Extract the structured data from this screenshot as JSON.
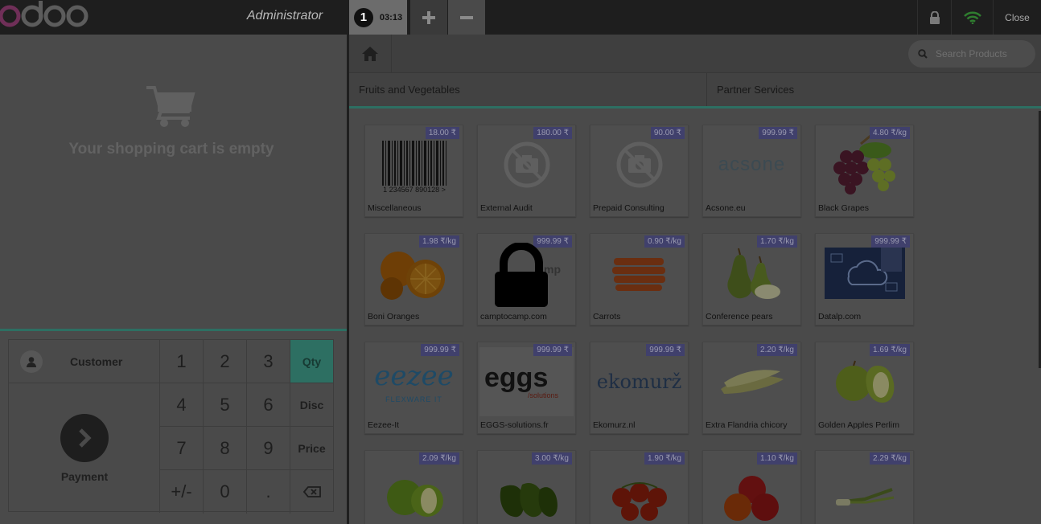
{
  "topbar": {
    "brand": "odoo",
    "user": "Administrator",
    "order_number": "1",
    "order_time": "03:13",
    "add_icon": "plus-icon",
    "remove_icon": "minus-icon",
    "close_label": "Close"
  },
  "cart": {
    "empty_text": "Your shopping cart is empty"
  },
  "numpad": {
    "customer_label": "Customer",
    "payment_label": "Payment",
    "keys": [
      "1",
      "2",
      "3",
      "4",
      "5",
      "6",
      "7",
      "8",
      "9",
      "+/-",
      "0",
      "."
    ],
    "modes": [
      "Qty",
      "Disc",
      "Price"
    ],
    "active_mode": "Qty"
  },
  "search": {
    "placeholder": "Search Products"
  },
  "categories": [
    "Fruits and Vegetables",
    "Partner Services"
  ],
  "products": [
    {
      "name": "Miscellaneous",
      "price": "18.00 ₹"
    },
    {
      "name": "External Audit",
      "price": "180.00 ₹"
    },
    {
      "name": "Prepaid Consulting",
      "price": "90.00 ₹"
    },
    {
      "name": "Acsone.eu",
      "price": "999.99 ₹"
    },
    {
      "name": "Black Grapes",
      "price": "4.80 ₹/kg"
    },
    {
      "name": "Boni Oranges",
      "price": "1.98 ₹/kg"
    },
    {
      "name": "camptocamp.com",
      "price": "999.99 ₹"
    },
    {
      "name": "Carrots",
      "price": "0.90 ₹/kg"
    },
    {
      "name": "Conference pears",
      "price": "1.70 ₹/kg"
    },
    {
      "name": "Datalp.com",
      "price": "999.99 ₹"
    },
    {
      "name": "Eezee-It",
      "price": "999.99 ₹"
    },
    {
      "name": "EGGS-solutions.fr",
      "price": "999.99 ₹"
    },
    {
      "name": "Ekomurz.nl",
      "price": "999.99 ₹"
    },
    {
      "name": "Extra Flandria chicory",
      "price": "2.20 ₹/kg"
    },
    {
      "name": "Golden Apples Perlim",
      "price": "1.69 ₹/kg"
    },
    {
      "name": "",
      "price": "2.09 ₹/kg"
    },
    {
      "name": "",
      "price": "3.00 ₹/kg"
    },
    {
      "name": "",
      "price": "1.90 ₹/kg"
    },
    {
      "name": "",
      "price": "1.10 ₹/kg"
    },
    {
      "name": "",
      "price": "2.29 ₹/kg"
    }
  ],
  "logos": {
    "barcode_digits": "1 234567 890128 >",
    "acsone": "acsone",
    "camptocamp_fragment": "mp",
    "eezee": "eezee",
    "eezee_sub": "FLEXWARE IT",
    "eggs": "eggs",
    "eggs_sub": "/solutions",
    "ekomurz": "ekomurž"
  }
}
